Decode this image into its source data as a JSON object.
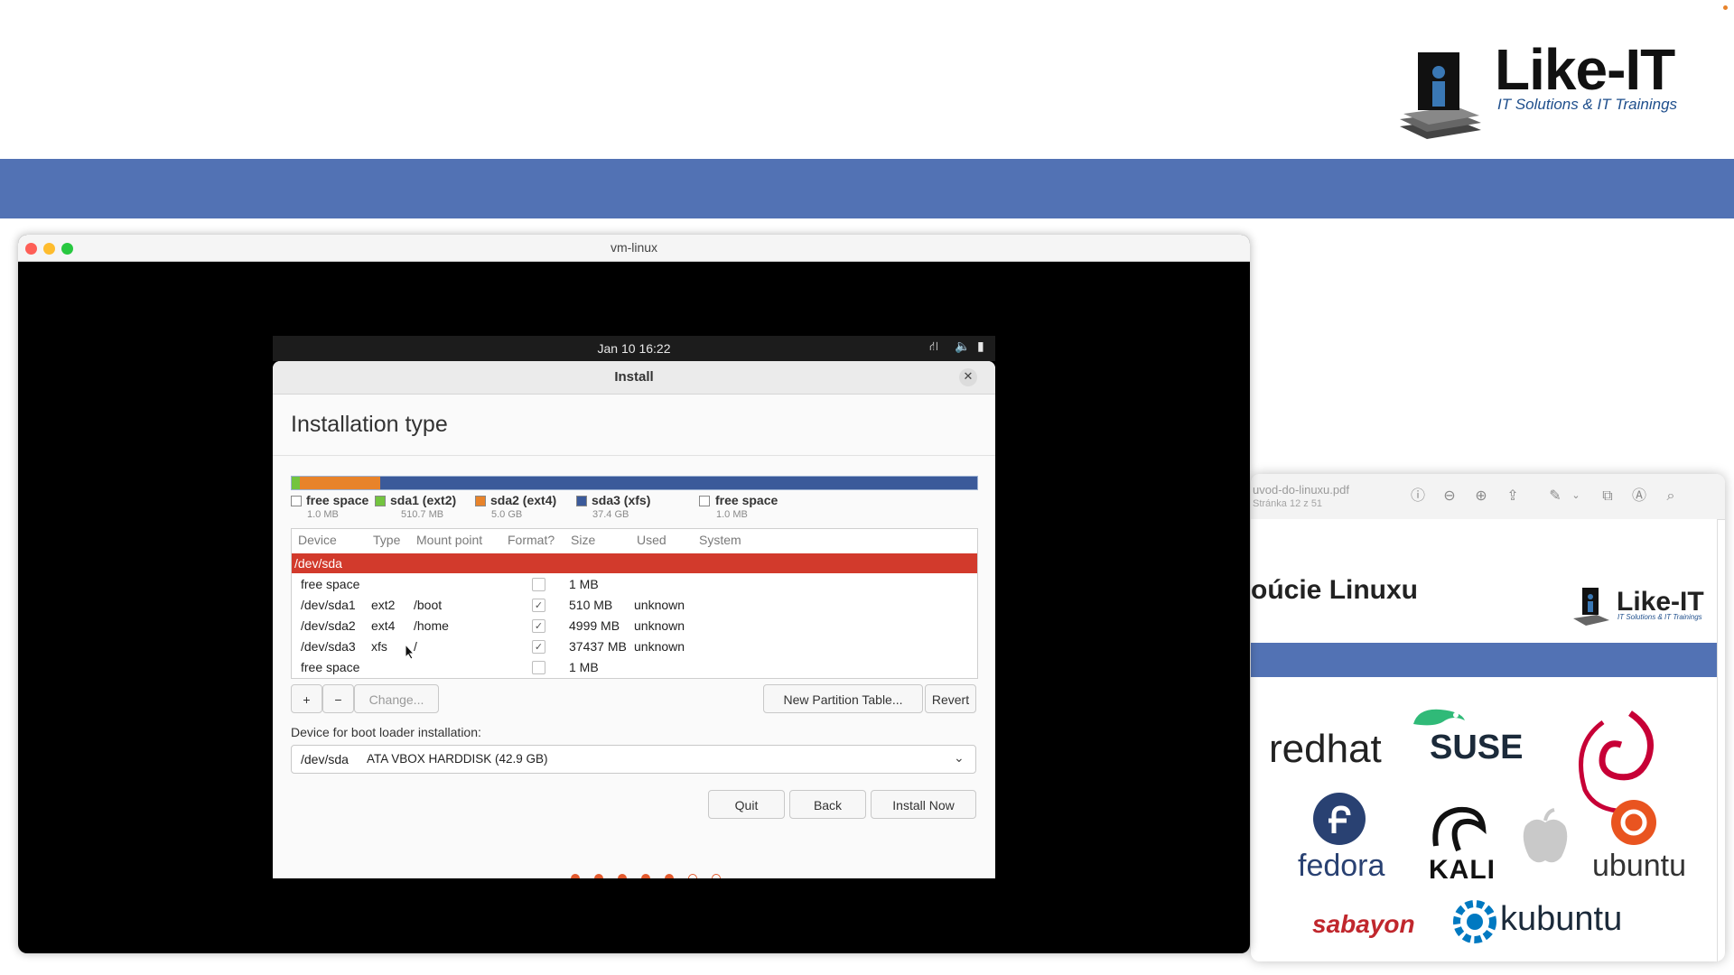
{
  "slide": {
    "logo_title": "Like-IT",
    "logo_subtitle": "IT Solutions & IT Trainings",
    "bar_color": "#5272b4"
  },
  "vm_window": {
    "title": "vm-linux"
  },
  "guest_topbar": {
    "clock": "Jan 10  16:22",
    "icons": [
      "network-icon",
      "volume-icon",
      "battery-icon"
    ]
  },
  "dialog": {
    "title": "Install",
    "heading": "Installation type",
    "legend": [
      {
        "name": "free space",
        "size": "1.0 MB",
        "color": "#ffffff"
      },
      {
        "name": "sda1 (ext2)",
        "size": "510.7 MB",
        "color": "#73c43f"
      },
      {
        "name": "sda2 (ext4)",
        "size": "5.0 GB",
        "color": "#e8832a"
      },
      {
        "name": "sda3 (xfs)",
        "size": "37.4 GB",
        "color": "#3b5a9a"
      },
      {
        "name": "free space",
        "size": "1.0 MB",
        "color": "#ffffff"
      }
    ],
    "table": {
      "headers": [
        "Device",
        "Type",
        "Mount point",
        "Format?",
        "Size",
        "Used",
        "System"
      ],
      "disk": "/dev/sda",
      "rows": [
        {
          "device": "free space",
          "type": "",
          "mount": "",
          "format": false,
          "size": "1 MB",
          "used": ""
        },
        {
          "device": "/dev/sda1",
          "type": "ext2",
          "mount": "/boot",
          "format": true,
          "size": "510 MB",
          "used": "unknown"
        },
        {
          "device": "/dev/sda2",
          "type": "ext4",
          "mount": "/home",
          "format": true,
          "size": "4999 MB",
          "used": "unknown"
        },
        {
          "device": "/dev/sda3",
          "type": "xfs",
          "mount": "/",
          "format": true,
          "size": "37437 MB",
          "used": "unknown"
        },
        {
          "device": "free space",
          "type": "",
          "mount": "",
          "format": false,
          "size": "1 MB",
          "used": ""
        }
      ]
    },
    "buttons": {
      "add": "+",
      "remove": "−",
      "change": "Change...",
      "new_table": "New Partition Table...",
      "revert": "Revert",
      "quit": "Quit",
      "back": "Back",
      "install": "Install Now"
    },
    "bootloader": {
      "label": "Device for boot loader installation:",
      "device": "/dev/sda",
      "description": "ATA VBOX HARDDISK (42.9 GB)"
    },
    "progress_steps": {
      "total": 7,
      "done": 5
    }
  },
  "pdf_viewer": {
    "filename": "uvod-do-linuxu.pdf",
    "page_info": "Stránka 12 z 51",
    "heading": "oúcie Linuxu",
    "logo_title": "Like-IT",
    "logo_subtitle": "IT Solutions & IT Trainings",
    "distros": [
      "redhat",
      "SUSE",
      "KALI",
      "fedora",
      "ubuntu",
      "sabayon",
      "kubuntu"
    ]
  }
}
